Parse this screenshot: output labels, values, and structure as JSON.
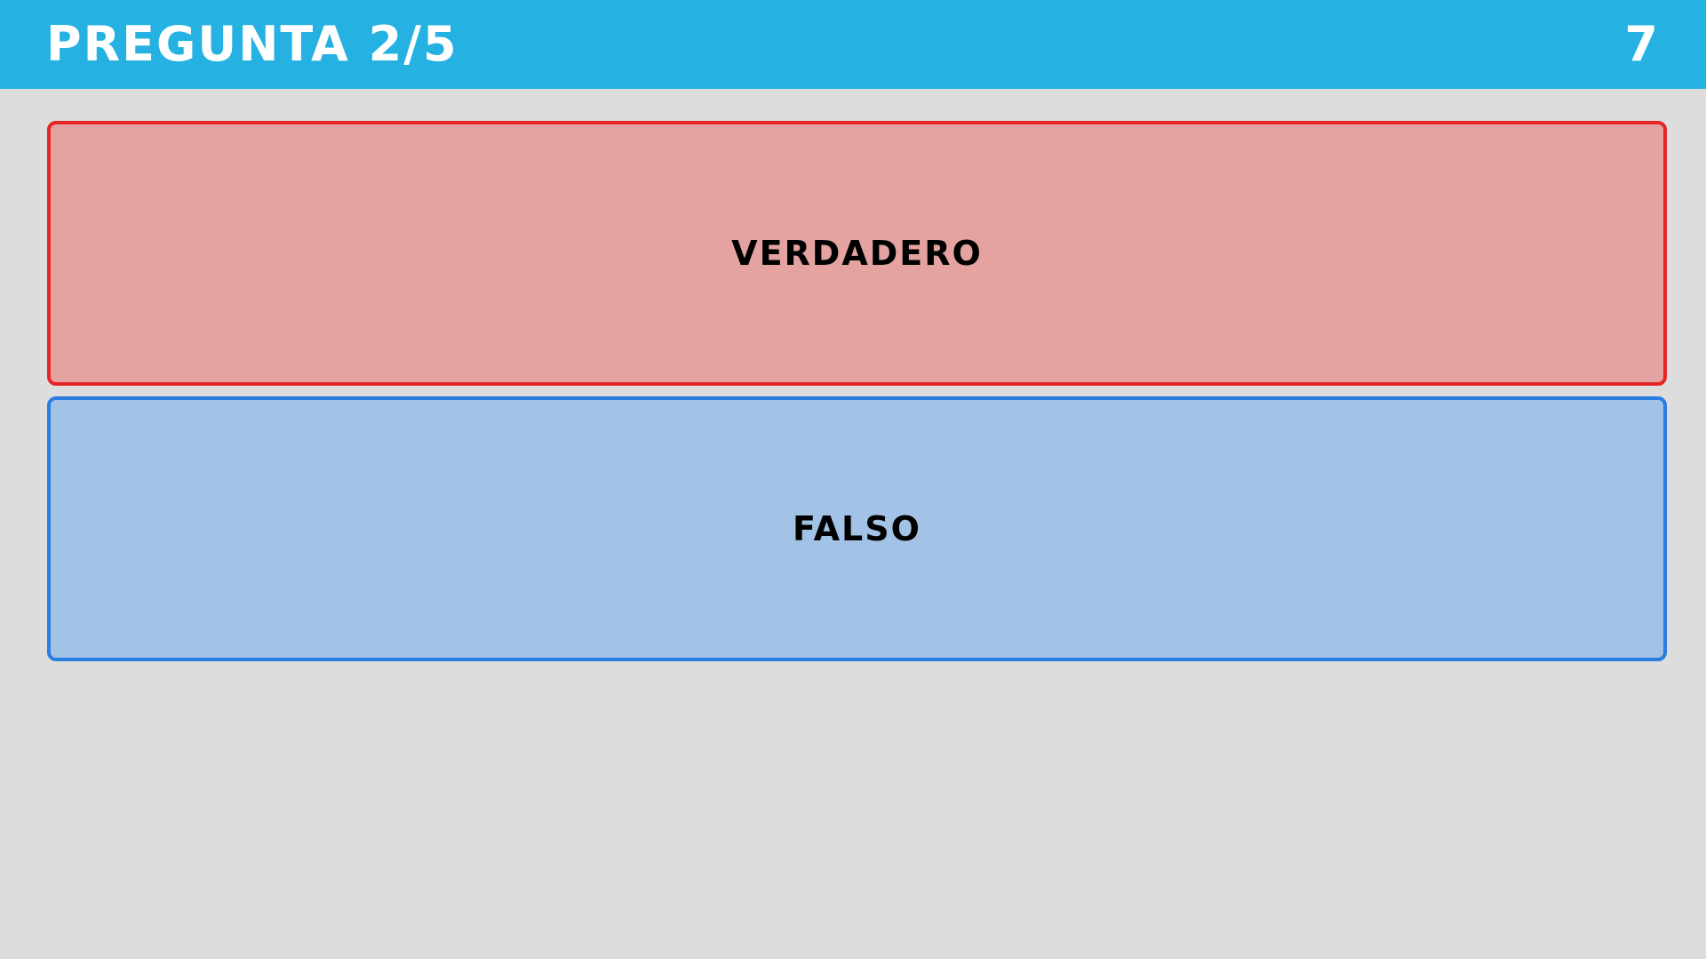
{
  "header": {
    "title": "PREGUNTA 2/5",
    "timer": "7"
  },
  "answers": [
    {
      "label": "VERDADERO",
      "border_color": "#e52626",
      "fill_color": "#e4a3a0"
    },
    {
      "label": "FALSO",
      "border_color": "#2a7de1",
      "fill_color": "#a2c3e5"
    }
  ],
  "colors": {
    "header_bg": "#25b2e2",
    "page_bg": "#dddddd"
  }
}
